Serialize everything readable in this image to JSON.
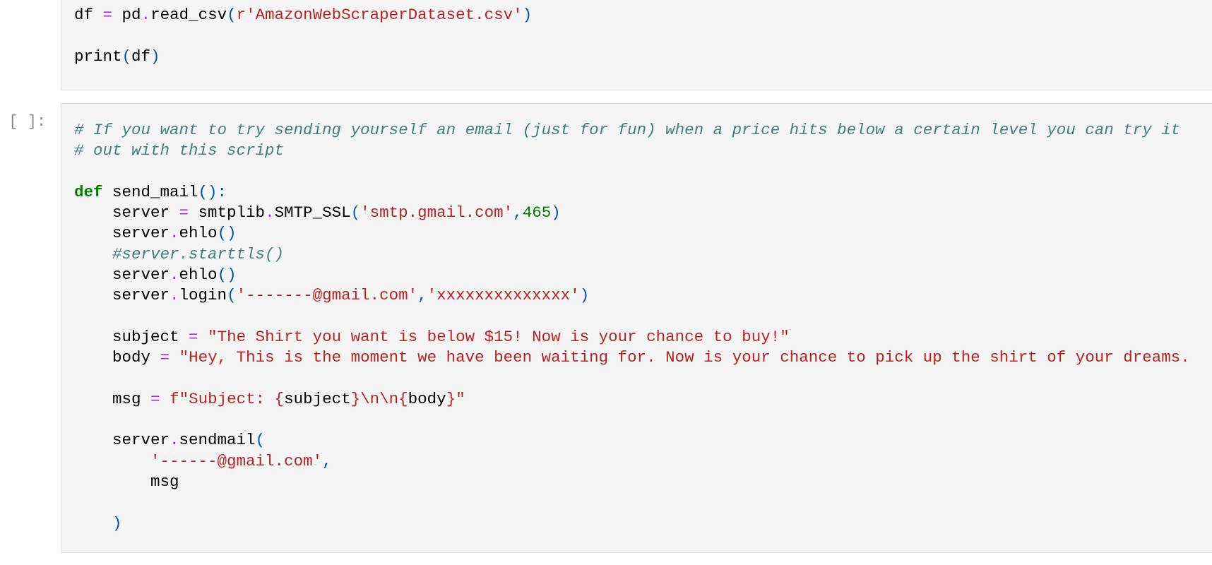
{
  "cell_1": {
    "prompt": "",
    "lines": [
      [
        [
          "df ",
          ""
        ],
        [
          "=",
          "op"
        ],
        [
          " pd",
          ""
        ],
        [
          ".",
          "op"
        ],
        [
          "read_csv",
          ""
        ],
        [
          "(",
          "p"
        ],
        [
          "r'AmazonWebScraperDataset.csv'",
          "str"
        ],
        [
          ")",
          "p"
        ]
      ],
      [
        [
          "",
          ""
        ]
      ],
      [
        [
          "print",
          ""
        ],
        [
          "(",
          "p"
        ],
        [
          "df",
          ""
        ],
        [
          ")",
          "p"
        ]
      ]
    ]
  },
  "cell_2": {
    "prompt": "n [ ]:",
    "lines": [
      [
        [
          "# If you want to try sending yourself an email (just for fun) when a price hits below a certain level you can try it",
          "cm"
        ]
      ],
      [
        [
          "# out with this script",
          "cm"
        ]
      ],
      [
        [
          "",
          ""
        ]
      ],
      [
        [
          "def",
          "kw"
        ],
        [
          " send_mail",
          ""
        ],
        [
          "():",
          "p"
        ]
      ],
      [
        [
          "    server ",
          ""
        ],
        [
          "=",
          "op"
        ],
        [
          " smtplib",
          ""
        ],
        [
          ".",
          "op"
        ],
        [
          "SMTP_SSL",
          ""
        ],
        [
          "(",
          "p"
        ],
        [
          "'smtp.gmail.com'",
          "str"
        ],
        [
          ",",
          "p"
        ],
        [
          "465",
          "num"
        ],
        [
          ")",
          "p"
        ]
      ],
      [
        [
          "    server",
          ""
        ],
        [
          ".",
          "op"
        ],
        [
          "ehlo",
          ""
        ],
        [
          "()",
          "p"
        ]
      ],
      [
        [
          "    #server.starttls()",
          "cm"
        ]
      ],
      [
        [
          "    server",
          ""
        ],
        [
          ".",
          "op"
        ],
        [
          "ehlo",
          ""
        ],
        [
          "()",
          "p"
        ]
      ],
      [
        [
          "    server",
          ""
        ],
        [
          ".",
          "op"
        ],
        [
          "login",
          ""
        ],
        [
          "(",
          "p"
        ],
        [
          "'-------@gmail.com'",
          "str"
        ],
        [
          ",",
          "p"
        ],
        [
          "'xxxxxxxxxxxxxx'",
          "str"
        ],
        [
          ")",
          "p"
        ]
      ],
      [
        [
          "",
          ""
        ]
      ],
      [
        [
          "    subject ",
          ""
        ],
        [
          "=",
          "op"
        ],
        [
          " ",
          ""
        ],
        [
          "\"The Shirt you want is below $15! Now is your chance to buy!\"",
          "str"
        ]
      ],
      [
        [
          "    body ",
          ""
        ],
        [
          "=",
          "op"
        ],
        [
          " ",
          ""
        ],
        [
          "\"Hey, This is the moment we have been waiting for. Now is your chance to pick up the shirt of your dreams.",
          "str"
        ]
      ],
      [
        [
          "",
          ""
        ]
      ],
      [
        [
          "    msg ",
          ""
        ],
        [
          "=",
          "op"
        ],
        [
          " ",
          ""
        ],
        [
          "f\"Subject: ",
          "str"
        ],
        [
          "{",
          "str"
        ],
        [
          "subject",
          ""
        ],
        [
          "}",
          "str"
        ],
        [
          "\\n\\n",
          "str"
        ],
        [
          "{",
          "str"
        ],
        [
          "body",
          ""
        ],
        [
          "}",
          "str"
        ],
        [
          "\"",
          "str"
        ]
      ],
      [
        [
          "",
          ""
        ]
      ],
      [
        [
          "    server",
          ""
        ],
        [
          ".",
          "op"
        ],
        [
          "sendmail",
          ""
        ],
        [
          "(",
          "p"
        ]
      ],
      [
        [
          "        ",
          ""
        ],
        [
          "'------@gmail.com'",
          "str"
        ],
        [
          ",",
          "p"
        ]
      ],
      [
        [
          "        msg",
          ""
        ]
      ],
      [
        [
          "",
          ""
        ]
      ],
      [
        [
          "    ",
          ""
        ],
        [
          ")",
          "p"
        ]
      ]
    ]
  },
  "colors": {
    "keyword": "#008000",
    "operator": "#aa22ff",
    "string": "#ba2121",
    "number": "#008000",
    "comment": "#408080",
    "punctuation": "#0055aa",
    "cell_background": "#f5f5f5"
  }
}
